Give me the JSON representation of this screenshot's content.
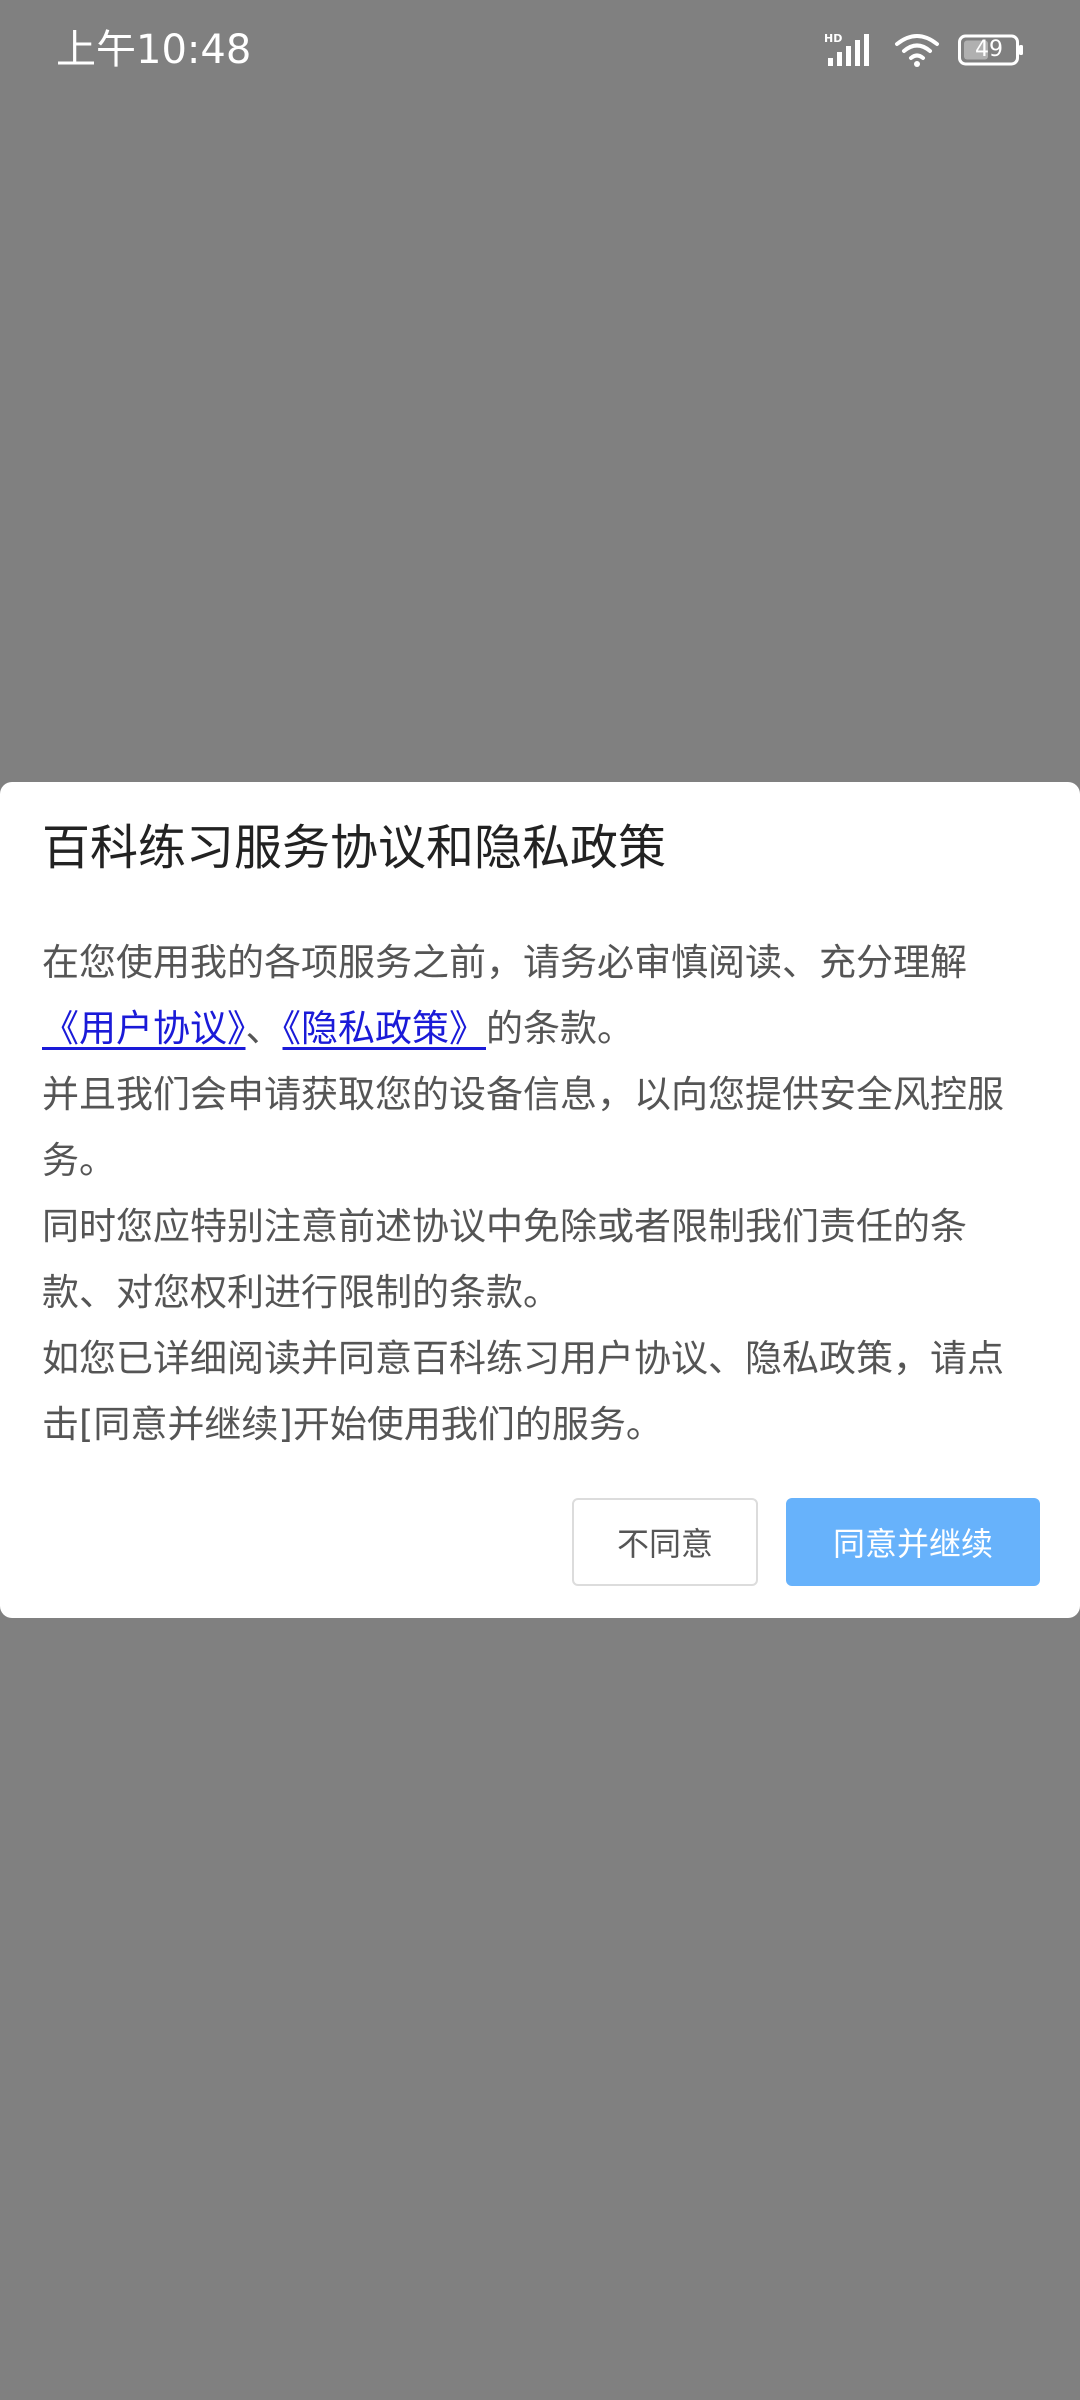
{
  "status_bar": {
    "time": "上午10:48",
    "network_badge": "HD",
    "battery": "49",
    "icons": [
      "signal-icon",
      "wifi-icon",
      "battery-icon"
    ]
  },
  "dialog": {
    "title": "百科练习服务协议和隐私政策",
    "p1_prefix": "在您使用我的各项服务之前，请务必审慎阅读、充分理解",
    "link_user_agreement": "《用户协议》",
    "separator": "、",
    "link_privacy_policy": "《隐私政策》",
    "p1_suffix": "的条款。",
    "p2": "并且我们会申请获取您的设备信息，以向您提供安全风控服务。",
    "p3": "同时您应特别注意前述协议中免除或者限制我们责任的条款、对您权利进行限制的条款。",
    "p4": "如您已详细阅读并同意百科练习用户协议、隐私政策，请点击[同意并继续]开始使用我们的服务。",
    "disagree_button": "不同意",
    "agree_button": "同意并继续"
  },
  "colors": {
    "overlay": "#808080",
    "dialog_bg": "#ffffff",
    "title": "#222222",
    "body_text": "#555555",
    "link": "#1a1ad8",
    "agree_button_bg": "#67b2fb",
    "disagree_border": "#dcdcdc"
  }
}
